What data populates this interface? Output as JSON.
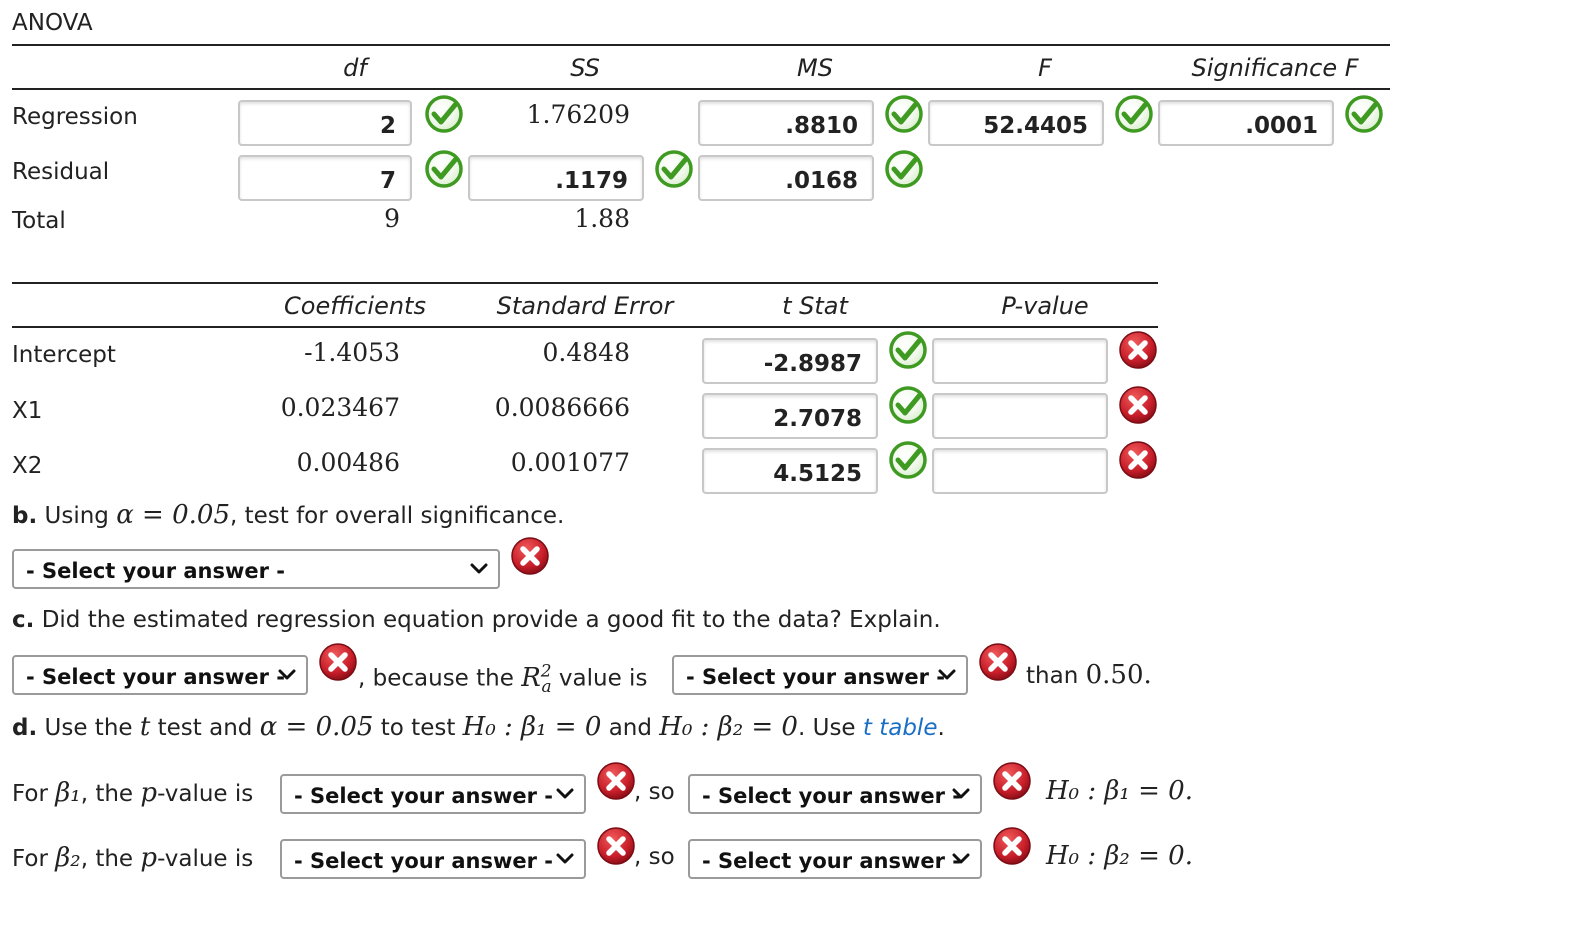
{
  "anova": {
    "title": "ANOVA",
    "headers": {
      "df": "df",
      "ss": "SS",
      "ms": "MS",
      "f": "F",
      "sigf": "Significance F"
    },
    "rows": [
      {
        "label": "Regression",
        "df": "2",
        "ss": "1.76209",
        "ms": ".8810",
        "f": "52.4405",
        "sigf": ".0001"
      },
      {
        "label": "Residual",
        "df": "7",
        "ss": ".1179",
        "ms": ".0168"
      },
      {
        "label": "Total",
        "df": "9",
        "ss": "1.88"
      }
    ]
  },
  "coef": {
    "headers": {
      "coef": "Coefficients",
      "se": "Standard Error",
      "t": "t Stat",
      "p": "P-value"
    },
    "rows": [
      {
        "label": "Intercept",
        "coef": "-1.4053",
        "se": "0.4848",
        "t": "-2.8987",
        "p": ""
      },
      {
        "label": "X1",
        "coef": "0.023467",
        "se": "0.0086666",
        "t": "2.7078",
        "p": ""
      },
      {
        "label": "X2",
        "coef": "0.00486",
        "se": "0.001077",
        "t": "4.5125",
        "p": ""
      }
    ]
  },
  "part_b": {
    "letter": "b.",
    "text1": "Using",
    "alpha_eq": "α = 0.05",
    "text2": ", test for overall significance.",
    "select": "- Select your answer -"
  },
  "part_c": {
    "letter": "c.",
    "question": "Did the estimated regression equation provide a good fit to the data? Explain.",
    "select1": "- Select your answer -",
    "text1": ", because the",
    "r2": "R",
    "r2_sup": "2",
    "r2_sub": "a",
    "text2": "value is",
    "select2": "- Select your answer -",
    "text3": "than",
    "threshold": "0.50."
  },
  "part_d": {
    "letter": "d.",
    "text1": "Use the",
    "t": "t",
    "text2": "test and",
    "alpha_eq": "α = 0.05",
    "text3": "to test",
    "h1": "H₀ : β₁ = 0",
    "and": "and",
    "h2": "H₀ : β₂ = 0",
    "text4": ". Use",
    "link": "t table",
    "period": ".",
    "row1": {
      "prefix": "For",
      "beta": "β₁",
      "mid": ", the",
      "p": "p",
      "suffix": "-value is",
      "select1": "- Select your answer -",
      "so": ", so",
      "select2": "- Select your answer -",
      "hyp": "H₀ : β₁ = 0."
    },
    "row2": {
      "prefix": "For",
      "beta": "β₂",
      "mid": ", the",
      "p": "p",
      "suffix": "-value is",
      "select1": "- Select your answer -",
      "so": ", so",
      "select2": "- Select your answer -",
      "hyp": "H₀ : β₂ = 0."
    }
  },
  "colors": {
    "correct": "#4caf2a",
    "wrong": "#c81e2a",
    "link": "#1a6fc4"
  },
  "icons": {
    "correct": "check-circle-icon",
    "wrong": "x-circle-icon",
    "dropdown": "chevron-down-icon"
  }
}
